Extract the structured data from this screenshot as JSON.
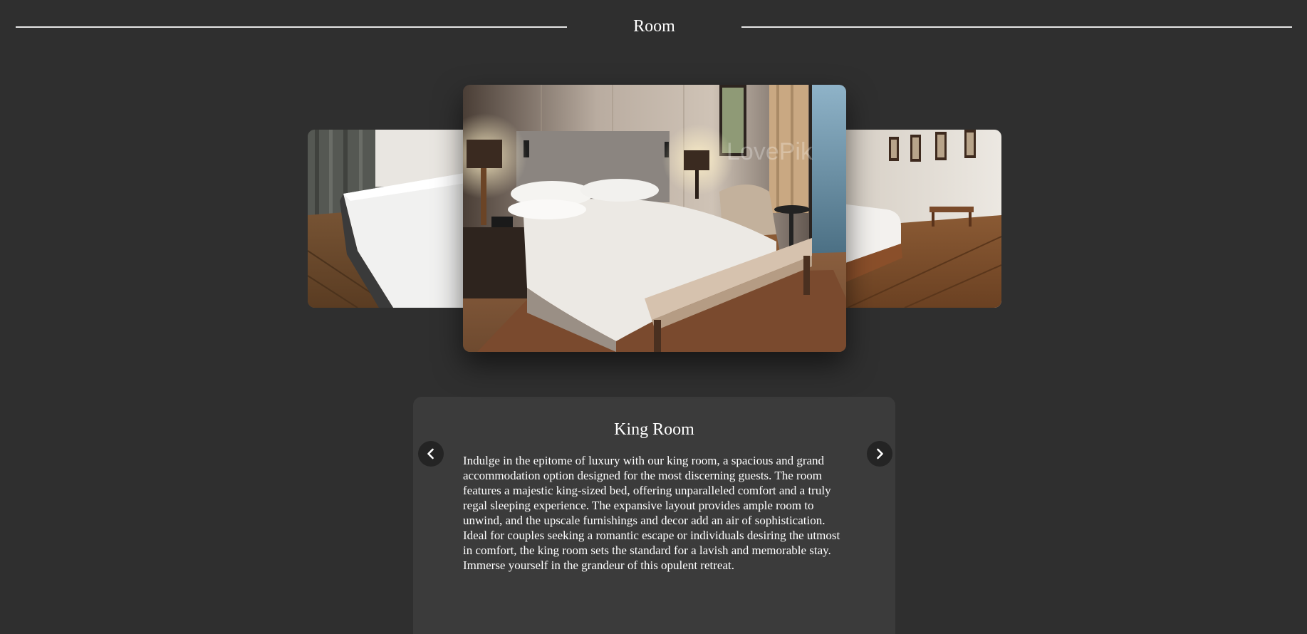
{
  "section": {
    "title": "Room"
  },
  "carousel": {
    "slides": [
      {
        "position": "previous",
        "image": "bedroom-photo-white-bed-curtains"
      },
      {
        "position": "current",
        "image": "bedroom-photo-king-bed-bench-lamps"
      },
      {
        "position": "next",
        "image": "bedroom-photo-wood-floor-framed-pictures"
      }
    ],
    "watermark": "LovePik"
  },
  "room": {
    "name": "King Room",
    "description": "Indulge in the epitome of luxury with our king room, a spacious and grand accommodation option designed for the most discerning guests. The room features a majestic king-sized bed, offering unparalleled comfort and a truly regal sleeping experience. The expansive layout provides ample room to unwind, and the upscale furnishings and decor add an air of sophistication. Ideal for couples seeking a romantic escape or individuals desiring the utmost in comfort, the king room sets the standard for a lavish and memorable stay. Immerse yourself in the grandeur of this opulent retreat."
  },
  "controls": {
    "prev_icon": "chevron-left-icon",
    "next_icon": "chevron-right-icon"
  },
  "colors": {
    "background": "#2f2f2f",
    "card": "#3b3b3b",
    "button": "#242424",
    "text": "#ffffff"
  }
}
